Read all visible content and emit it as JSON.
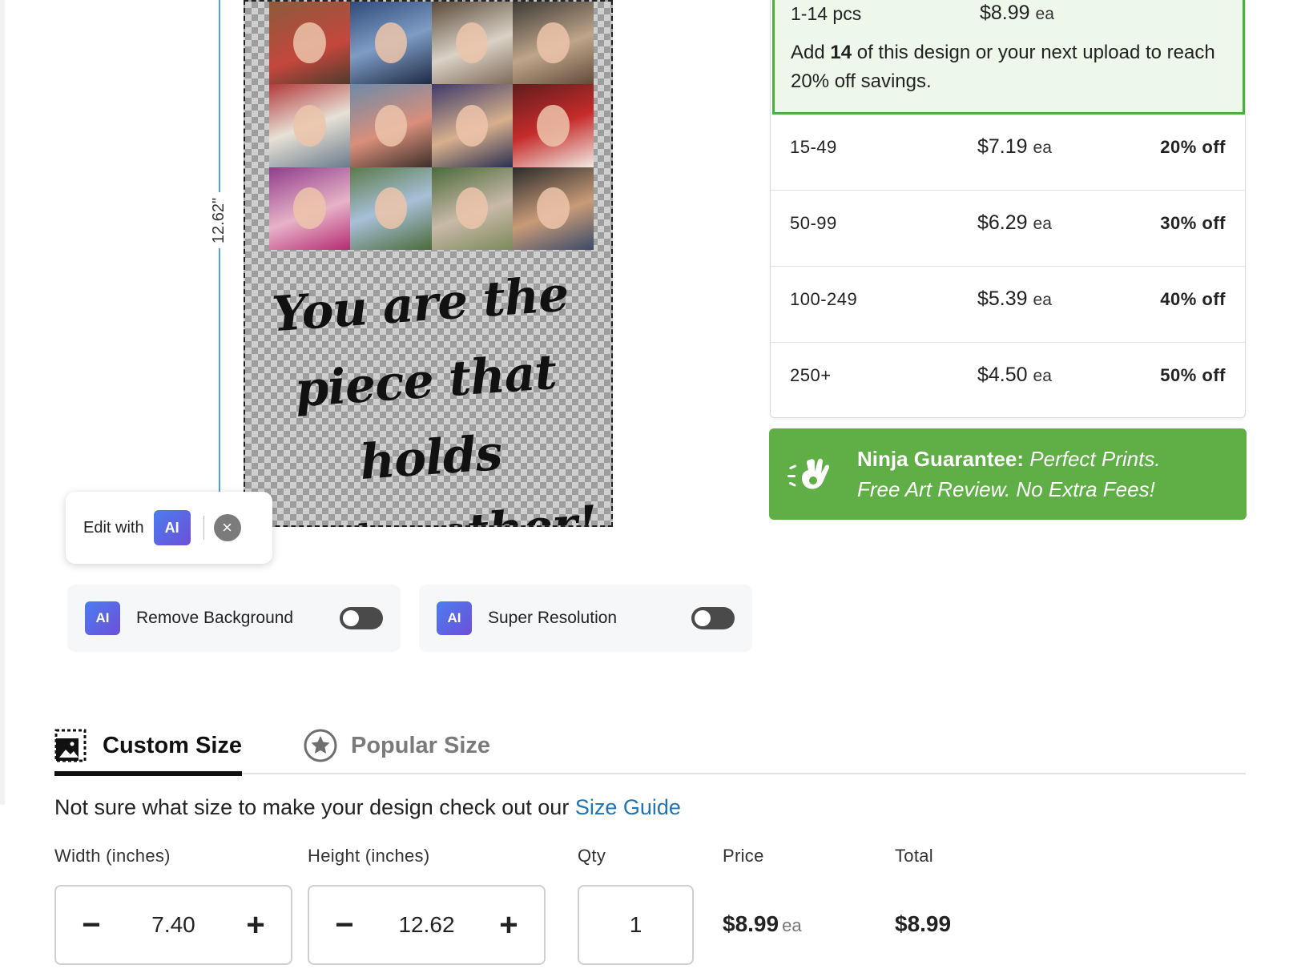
{
  "canvas": {
    "height_label": "12.62\"",
    "quote_line1": "You are the",
    "quote_line2": "piece that holds",
    "quote_line3": "us together!"
  },
  "edit_ai": {
    "label": "Edit with",
    "badge": "AI",
    "close_icon": "close-icon"
  },
  "ai_tools": [
    {
      "badge": "AI",
      "label": "Remove Background",
      "enabled": false
    },
    {
      "badge": "AI",
      "label": "Super Resolution",
      "enabled": false
    }
  ],
  "pricing": {
    "active_tier": {
      "qty": "1-14 pcs",
      "price": "$8.99",
      "unit": "ea",
      "msg_pre": "Add ",
      "msg_count": "14",
      "msg_post": " of this design or your next upload to reach 20% off savings."
    },
    "tiers": [
      {
        "qty": "15-49",
        "price": "$7.19",
        "unit": "ea",
        "off": "20% off"
      },
      {
        "qty": "50-99",
        "price": "$6.29",
        "unit": "ea",
        "off": "30% off"
      },
      {
        "qty": "100-249",
        "price": "$5.39",
        "unit": "ea",
        "off": "40% off"
      },
      {
        "qty": "250+",
        "price": "$4.50",
        "unit": "ea",
        "off": "50% off"
      }
    ]
  },
  "guarantee": {
    "title": "Ninja Guarantee:",
    "line1_italic": " Perfect Prints.",
    "line2_italic": "Free Art Review. No Extra Fees!"
  },
  "tabs": [
    {
      "label": "Custom Size",
      "icon": "custom-size-icon",
      "active": true
    },
    {
      "label": "Popular Size",
      "icon": "star-icon",
      "active": false
    }
  ],
  "size_help": {
    "text": "Not sure what size to make your design check out our ",
    "link": "Size Guide"
  },
  "form": {
    "width_label": "Width (inches)",
    "height_label": "Height (inches)",
    "qty_label": "Qty",
    "price_label": "Price",
    "total_label": "Total",
    "width_value": "7.40",
    "height_value": "12.62",
    "qty_value": "1",
    "price_value": "$8.99",
    "price_unit": "ea",
    "total_value": "$8.99",
    "minus": "−",
    "plus": "+"
  },
  "colors": {
    "accent_green": "#5fae46",
    "active_tier_border": "#4caf3f",
    "link_blue": "#1f73b7",
    "ai_badge": "#4c7df0"
  }
}
